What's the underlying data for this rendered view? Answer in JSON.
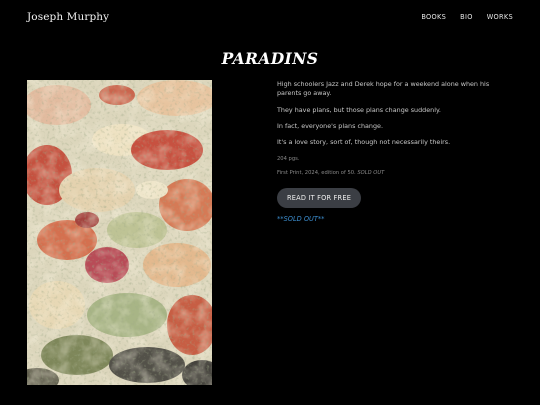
{
  "header": {
    "site_title": "Joseph Murphy",
    "nav": [
      {
        "label": "BOOKS"
      },
      {
        "label": "BIO"
      },
      {
        "label": "WORKS"
      }
    ]
  },
  "book": {
    "title": "PARADINS",
    "cover_colors": [
      "#d8d4bd",
      "#c23a2a",
      "#d46b45",
      "#e8c9a0",
      "#9fb07d",
      "#6e7a4a",
      "#3c3a36",
      "#f0e6c8",
      "#b23446"
    ],
    "paragraphs": [
      "High schoolers Jazz and Derek hope for a weekend alone when his parents go away.",
      "They have plans, but those plans change suddenly.",
      "In fact, everyone's plans change.",
      "It's a love story, sort of, though not necessarily theirs."
    ],
    "pages": "204 pgs.",
    "edition_prefix": "First Print, 2024, edition of 50.",
    "edition_status": "SOLD OUT",
    "read_button": "READ IT FOR FREE",
    "sold_out_note": "**SOLD OUT**"
  }
}
